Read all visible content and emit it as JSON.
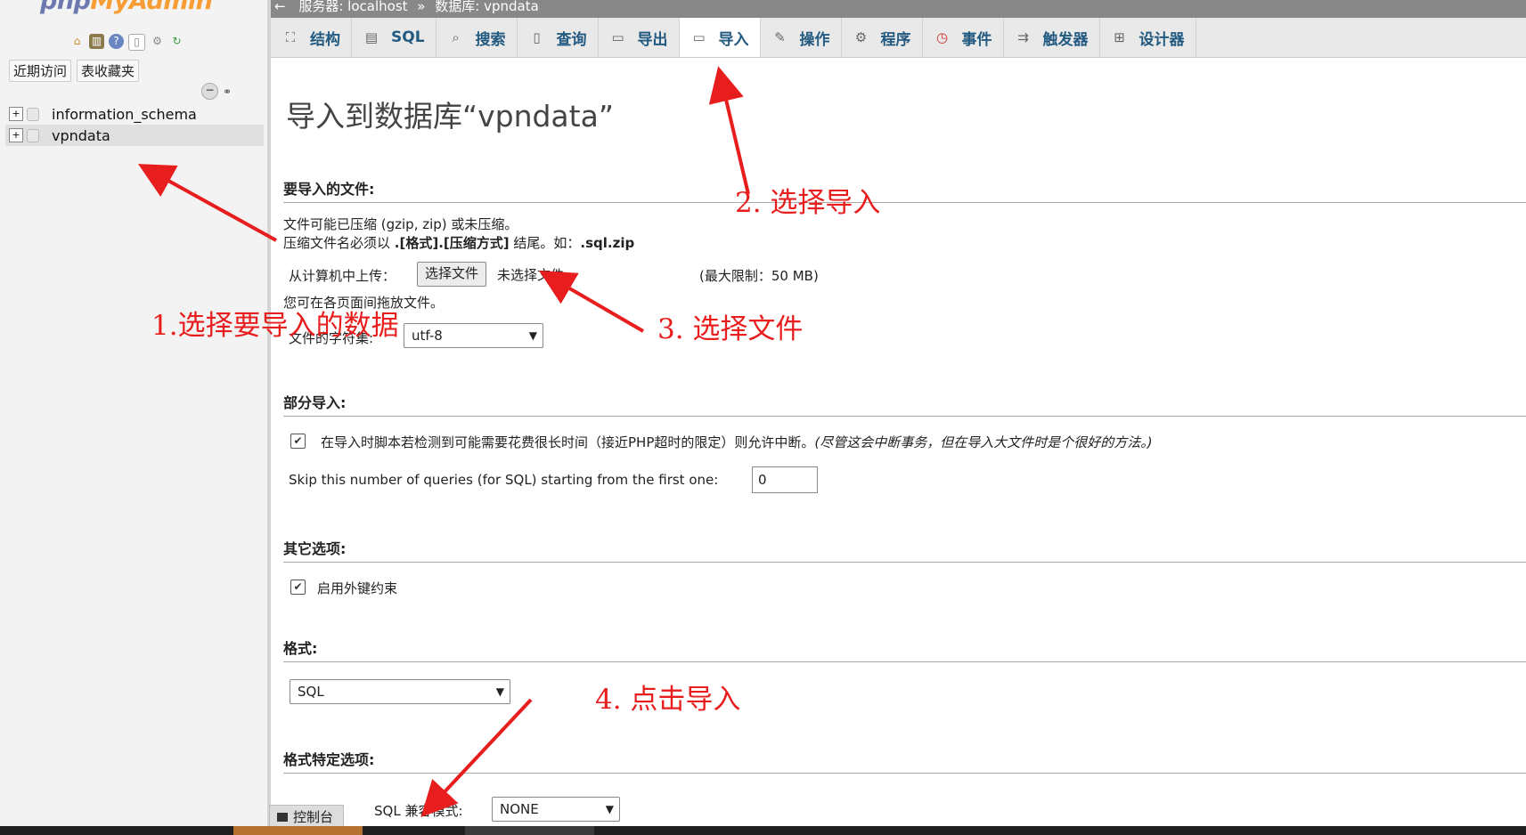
{
  "sidebar": {
    "logo_a": "php",
    "logo_b": "MyAdmin",
    "quick_icons": [
      "home-icon",
      "database-icon",
      "help-icon",
      "docs-icon",
      "settings-icon",
      "reload-icon"
    ],
    "tabs": [
      "近期访问",
      "表收藏夹"
    ],
    "databases": [
      {
        "name": "information_schema",
        "selected": false
      },
      {
        "name": "vpndata",
        "selected": true
      }
    ]
  },
  "breadcrumb": {
    "back": "←",
    "server": "服务器: localhost",
    "sep": "»",
    "database": "数据库: vpndata"
  },
  "tabs": [
    {
      "label": "结构",
      "icon": "structure-icon"
    },
    {
      "label": "SQL",
      "icon": "sql-icon"
    },
    {
      "label": "搜索",
      "icon": "search-icon"
    },
    {
      "label": "查询",
      "icon": "query-icon"
    },
    {
      "label": "导出",
      "icon": "export-icon"
    },
    {
      "label": "导入",
      "icon": "import-icon",
      "active": true
    },
    {
      "label": "操作",
      "icon": "wrench-icon"
    },
    {
      "label": "程序",
      "icon": "routines-icon"
    },
    {
      "label": "事件",
      "icon": "clock-icon"
    },
    {
      "label": "触发器",
      "icon": "trigger-icon"
    },
    {
      "label": "设计器",
      "icon": "designer-icon"
    }
  ],
  "main": {
    "title": "导入到数据库“vpndata”",
    "file_section": "要导入的文件:",
    "compress_note": "文件可能已压缩 (gzip, zip) 或未压缩。",
    "compress_rule_a": "压缩文件名必须以 ",
    "compress_rule_b": ".[格式].[压缩方式]",
    "compress_rule_c": " 结尾。如：",
    "compress_rule_d": ".sql.zip",
    "upload_label": "从计算机中上传：",
    "choose_file": "选择文件",
    "no_file": "未选择文件",
    "max_limit": "(最大限制：50 MB)",
    "drag_note": "您可在各页面间拖放文件。",
    "charset_label": "文件的字符集:",
    "charset_value": "utf-8",
    "partial_section": "部分导入:",
    "interrupt_label": "在导入时脚本若检测到可能需要花费很长时间（接近PHP超时的限定）则允许中断。",
    "interrupt_note": "(尽管这会中断事务，但在导入大文件时是个很好的方法。)",
    "interrupt_checked": true,
    "skip_label": "Skip this number of queries (for SQL) starting from the first one:",
    "skip_value": "0",
    "other_section": "其它选项:",
    "fk_label": "启用外键约束",
    "fk_checked": true,
    "format_section": "格式:",
    "format_value": "SQL",
    "format_options_section": "格式特定选项:",
    "compat_label": "SQL 兼容模式:",
    "compat_value": "NONE",
    "console_label": "控制台"
  },
  "annotations": {
    "a1": "1.选择要导入的数据",
    "a2": "2. 选择导入",
    "a3": "3. 选择文件",
    "a4": "4. 点击导入",
    "color": "#e81e1e"
  }
}
